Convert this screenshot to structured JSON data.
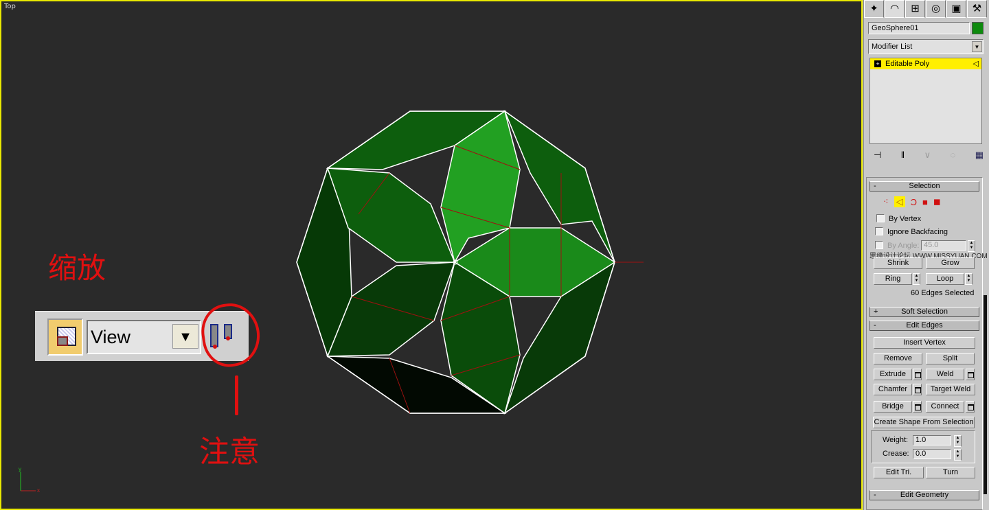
{
  "viewport": {
    "label": "Top",
    "axis_x": "x",
    "axis_y": "y"
  },
  "annotations": {
    "zoom": "缩放",
    "note": "注意",
    "color": "#e01010"
  },
  "toolbar": {
    "view_dropdown": "View"
  },
  "object": {
    "color": "#1a8a1a",
    "face_colors": [
      "#0d5e0d",
      "#22a022",
      "#063906",
      "#083a08",
      "#0a4c0a",
      "#020902"
    ]
  },
  "panel": {
    "tabs": [
      "create",
      "modify",
      "hierarchy",
      "motion",
      "display",
      "utilities"
    ],
    "object_name": "GeoSphere01",
    "object_color": "#0d8a0d",
    "modifier_list": "Modifier List",
    "stack_item": "Editable Poly",
    "selection": {
      "title": "Selection",
      "by_vertex": "By Vertex",
      "ignore_backfacing": "Ignore Backfacing",
      "by_angle": "By Angle:",
      "by_angle_value": "45.0",
      "shrink": "Shrink",
      "grow": "Grow",
      "ring": "Ring",
      "loop": "Loop",
      "status": "60 Edges Selected"
    },
    "watermark": "思缘设计论坛  WWW.MISSYUAN.COM",
    "soft_selection": {
      "title": "Soft Selection",
      "toggle": "+"
    },
    "edit_edges": {
      "title": "Edit Edges",
      "toggle": "-",
      "insert_vertex": "Insert Vertex",
      "remove": "Remove",
      "split": "Split",
      "extrude": "Extrude",
      "weld": "Weld",
      "chamfer": "Chamfer",
      "target_weld": "Target Weld",
      "bridge": "Bridge",
      "connect": "Connect",
      "create_shape": "Create Shape From Selection",
      "weight_label": "Weight:",
      "weight_value": "1.0",
      "crease_label": "Crease:",
      "crease_value": "0.0",
      "edit_tri": "Edit Tri.",
      "turn": "Turn"
    },
    "edit_geometry": {
      "title": "Edit Geometry",
      "toggle": "-"
    },
    "collapse": "-"
  }
}
